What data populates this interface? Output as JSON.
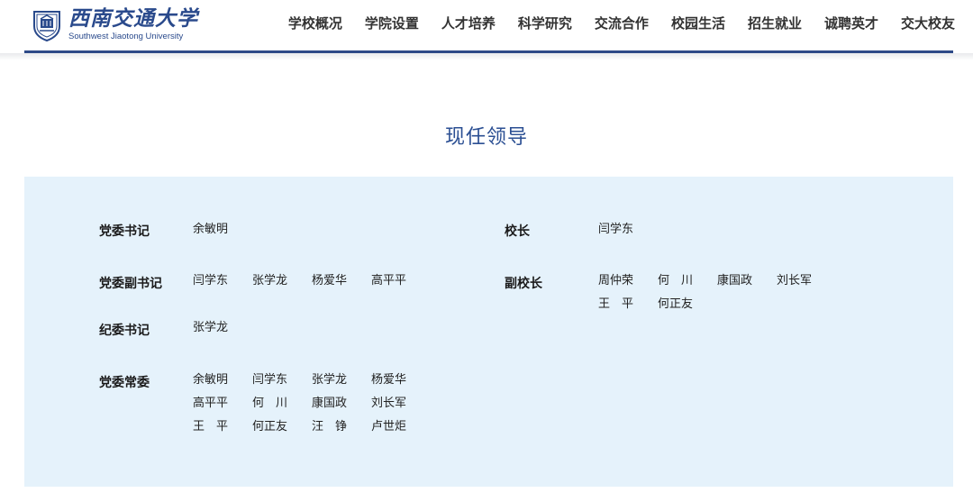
{
  "header": {
    "logo_cn": "西南交通大学",
    "logo_en": "Southwest Jiaotong University",
    "nav": [
      "学校概况",
      "学院设置",
      "人才培养",
      "科学研究",
      "交流合作",
      "校园生活",
      "招生就业",
      "诚聘英才",
      "交大校友"
    ]
  },
  "page_title": "现任领导",
  "leaders": {
    "party_secretary": {
      "label": "党委书记",
      "names": [
        "余敏明"
      ]
    },
    "deputy_party_secretary": {
      "label": "党委副书记",
      "names": [
        "闫学东",
        "张学龙",
        "杨爱华",
        "高平平"
      ]
    },
    "discipline_secretary": {
      "label": "纪委书记",
      "names": [
        "张学龙"
      ]
    },
    "standing_committee": {
      "label": "党委常委",
      "names": [
        "余敏明",
        "闫学东",
        "张学龙",
        "杨爱华",
        "高平平",
        "何　川",
        "康国政",
        "刘长军",
        "王　平",
        "何正友",
        "汪　铮",
        "卢世炬"
      ]
    },
    "president": {
      "label": "校长",
      "names": [
        "闫学东"
      ]
    },
    "vice_president": {
      "label": "副校长",
      "names": [
        "周仲荣",
        "何　川",
        "康国政",
        "刘长军",
        "王　平",
        "何正友"
      ]
    }
  },
  "colors": {
    "brand": "#2d4a87",
    "title": "#2b4f93",
    "panel": "#e5f2fb"
  }
}
